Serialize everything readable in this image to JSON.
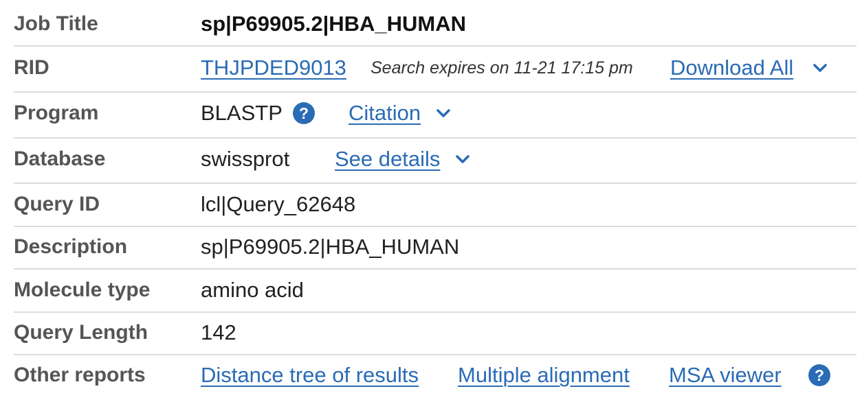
{
  "summary": {
    "job_title": {
      "label": "Job Title",
      "value": "sp|P69905.2|HBA_HUMAN"
    },
    "rid": {
      "label": "RID",
      "value": "THJPDED9013",
      "expires": "Search expires on 11-21 17:15 pm",
      "download_label": "Download All"
    },
    "program": {
      "label": "Program",
      "value": "BLASTP",
      "citation_label": "Citation"
    },
    "database": {
      "label": "Database",
      "value": "swissprot",
      "details_label": "See details"
    },
    "query_id": {
      "label": "Query ID",
      "value": "lcl|Query_62648"
    },
    "description": {
      "label": "Description",
      "value": "sp|P69905.2|HBA_HUMAN"
    },
    "molecule_type": {
      "label": "Molecule type",
      "value": "amino acid"
    },
    "query_length": {
      "label": "Query Length",
      "value": "142"
    },
    "other_reports": {
      "label": "Other reports",
      "links": [
        "Distance tree of results",
        "Multiple alignment",
        "MSA viewer"
      ]
    }
  },
  "icons": {
    "help": "help-circle-icon",
    "dropdown": "chevron-down-icon"
  },
  "colors": {
    "link": "#2a6bb5",
    "label": "#555555",
    "help_icon": "#2a6bb5",
    "divider": "#dcdcdc"
  }
}
